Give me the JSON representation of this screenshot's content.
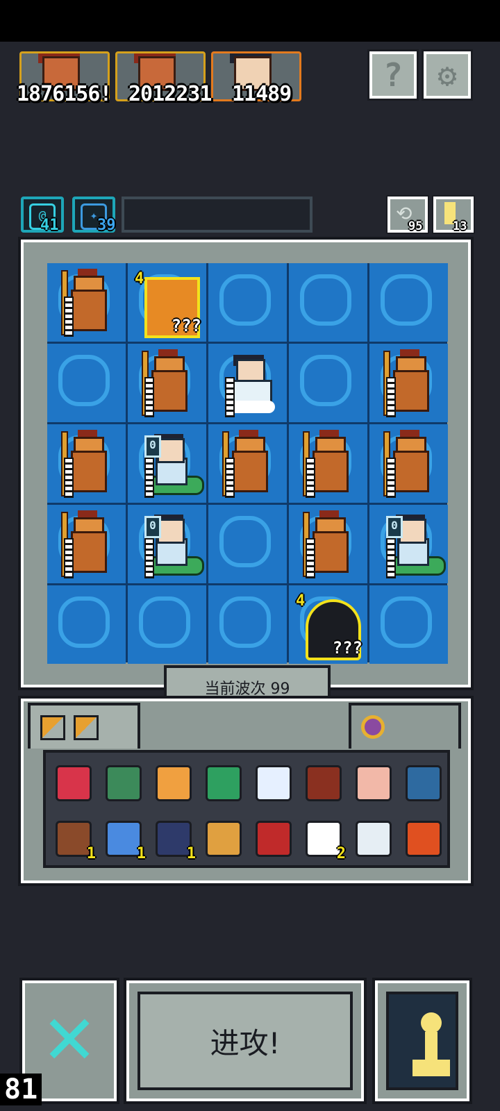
{
  "heroes": [
    {
      "damage": "1876156!",
      "type": "monkey"
    },
    {
      "damage": "2012231",
      "type": "monkey"
    },
    {
      "damage": "11489",
      "type": "lady"
    }
  ],
  "top_buttons": {
    "help_label": "?",
    "settings_icon": "gear-icon"
  },
  "resources": {
    "gem": "41",
    "boost": "39",
    "refresh": "95",
    "keys": "13"
  },
  "board": {
    "cells": [
      [
        "monkey",
        "mystery-box",
        "empty",
        "empty",
        "empty"
      ],
      [
        "empty",
        "monkey",
        "lady-cloud",
        "empty",
        "monkey"
      ],
      [
        "monkey",
        "snake-lady",
        "monkey",
        "monkey",
        "monkey"
      ],
      [
        "monkey",
        "snake-lady",
        "empty",
        "monkey",
        "snake-lady"
      ],
      [
        "empty",
        "empty",
        "empty",
        "mystery-portal",
        "empty"
      ]
    ],
    "mystery_level": "4",
    "mystery_text": "???",
    "snake_level": "0"
  },
  "wave": {
    "label": "当前波次 99"
  },
  "inventory": {
    "items": [
      {
        "name": "goggles",
        "count": "",
        "color": "#d8344a"
      },
      {
        "name": "turtle-shell",
        "count": "",
        "color": "#3c8a5a"
      },
      {
        "name": "scroll",
        "count": "",
        "color": "#f0a040"
      },
      {
        "name": "leaf-ring",
        "count": "",
        "color": "#2ea060"
      },
      {
        "name": "crystal-gear",
        "count": "",
        "color": "#e6f0ff"
      },
      {
        "name": "abacus",
        "count": "",
        "color": "#8a3020"
      },
      {
        "name": "finger",
        "count": "",
        "color": "#f2b8a8"
      },
      {
        "name": "portrait",
        "count": "",
        "color": "#2e6aa0"
      },
      {
        "name": "spyglass",
        "count": "1",
        "color": "#8a4a2a"
      },
      {
        "name": "blue-gem",
        "count": "1",
        "color": "#4a8ae0"
      },
      {
        "name": "pagoda",
        "count": "1",
        "color": "#2e3a6a"
      },
      {
        "name": "ship",
        "count": "",
        "color": "#e0a040"
      },
      {
        "name": "red-pouch",
        "count": "",
        "color": "#c02a2a"
      },
      {
        "name": "cloud",
        "count": "2",
        "color": "#ffffff"
      },
      {
        "name": "feather",
        "count": "",
        "color": "#e6eef4"
      },
      {
        "name": "fire",
        "count": "",
        "color": "#e05020"
      }
    ]
  },
  "bottom": {
    "attack_label": "进攻!",
    "counter": "81"
  }
}
